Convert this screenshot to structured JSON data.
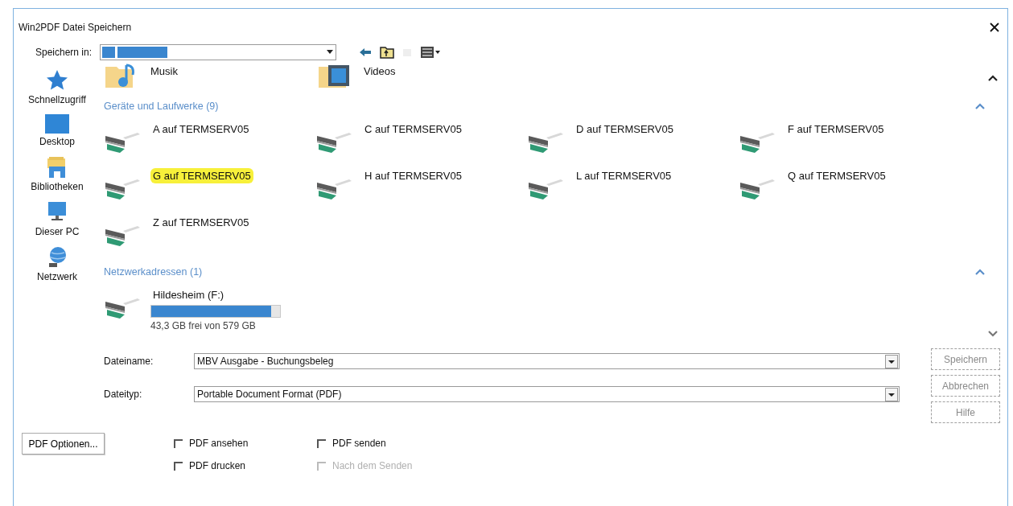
{
  "window": {
    "title": "Win2PDF Datei Speichern"
  },
  "save_in": {
    "label": "Speichern in:"
  },
  "sidebar": {
    "items": [
      {
        "label": "Schnellzugriff",
        "kind": "star"
      },
      {
        "label": "Desktop",
        "kind": "desktop"
      },
      {
        "label": "Bibliotheken",
        "kind": "library"
      },
      {
        "label": "Dieser PC",
        "kind": "pc"
      },
      {
        "label": "Netzwerk",
        "kind": "network"
      }
    ]
  },
  "folders": [
    {
      "name": "Musik",
      "kind": "music"
    },
    {
      "name": "Videos",
      "kind": "video"
    }
  ],
  "groups": [
    {
      "title": "Geräte und Laufwerke (9)",
      "expanded": true,
      "drives": [
        {
          "name": "A auf TERMSERV05",
          "highlighted": false
        },
        {
          "name": "C auf TERMSERV05",
          "highlighted": false
        },
        {
          "name": "D auf TERMSERV05",
          "highlighted": false
        },
        {
          "name": "F auf TERMSERV05",
          "highlighted": false
        },
        {
          "name": "G auf TERMSERV05",
          "highlighted": true
        },
        {
          "name": "H auf TERMSERV05",
          "highlighted": false
        },
        {
          "name": "L auf TERMSERV05",
          "highlighted": false
        },
        {
          "name": "Q auf TERMSERV05",
          "highlighted": false
        },
        {
          "name": "Z auf TERMSERV05",
          "highlighted": false
        }
      ]
    },
    {
      "title": "Netzwerkadressen (1)",
      "expanded": true,
      "drives": [
        {
          "name": "Hildesheim (F:)",
          "highlighted": false,
          "level": 0.93,
          "free": "43,3 GB frei von 579 GB"
        }
      ]
    }
  ],
  "file_name": {
    "label": "Dateiname:",
    "value": "MBV Ausgabe - Buchungsbeleg"
  },
  "file_type": {
    "label": "Dateityp:",
    "value": "Portable Document Format (PDF)"
  },
  "buttons": [
    {
      "label": "Speichern",
      "disabled": true
    },
    {
      "label": "Abbrechen",
      "disabled": true
    },
    {
      "label": "Hilfe",
      "disabled": true
    }
  ],
  "options_button": {
    "label": "PDF Optionen..."
  },
  "checkboxes": [
    {
      "label": "PDF ansehen",
      "checked": false,
      "disabled": false
    },
    {
      "label": "PDF senden",
      "checked": false,
      "disabled": false
    },
    {
      "label": "PDF drucken",
      "checked": false,
      "disabled": false
    },
    {
      "label": "Nach dem Senden",
      "checked": false,
      "disabled": true
    }
  ]
}
